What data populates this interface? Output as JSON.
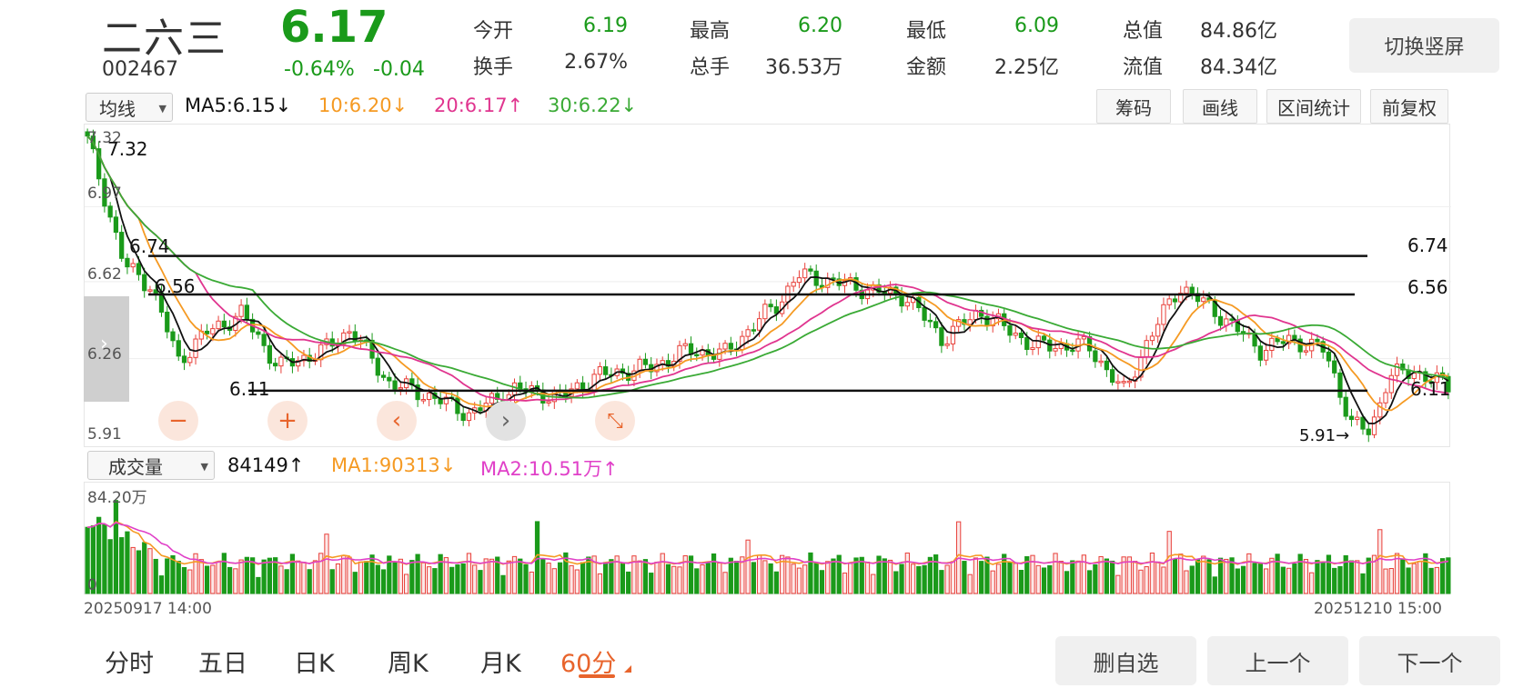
{
  "header": {
    "name": "二六三",
    "code": "002467",
    "price": "6.17",
    "change_pct": "-0.64%",
    "change_abs": "-0.04",
    "stats": [
      {
        "label": "今开",
        "value": "6.19",
        "color": "#1a9a1a"
      },
      {
        "label": "最高",
        "value": "6.20",
        "color": "#1a9a1a"
      },
      {
        "label": "最低",
        "value": "6.09",
        "color": "#1a9a1a"
      },
      {
        "label": "总值",
        "value": "84.86亿",
        "color": "#333333"
      },
      {
        "label": "换手",
        "value": "2.67%",
        "color": "#333333"
      },
      {
        "label": "总手",
        "value": "36.53万",
        "color": "#333333"
      },
      {
        "label": "金额",
        "value": "2.25亿",
        "color": "#333333"
      },
      {
        "label": "流值",
        "value": "84.34亿",
        "color": "#333333"
      }
    ],
    "switch_label": "切换竖屏"
  },
  "ma_bar": {
    "select_label": "均线",
    "ma5": "MA5:6.15↓",
    "ma10": "10:6.20↓",
    "ma20": "20:6.17↑",
    "ma30": "30:6.22↓",
    "tools": [
      "筹码",
      "画线",
      "区间统计",
      "前复权"
    ]
  },
  "price_chart": {
    "axis_labels": [
      "7.32",
      "6.97",
      "6.62",
      "6.26",
      "5.91"
    ],
    "level_labels": {
      "l674_left": "6.74",
      "l656_left": "6.56",
      "l611_left": "6.11",
      "l674_right": "6.74",
      "l656_right": "6.56",
      "l611_right": "6.11",
      "peak": "7.32",
      "low_marker": "5.91→"
    },
    "controls": {
      "zoom_out": "−",
      "zoom_in": "+",
      "prev": "‹",
      "next": "›",
      "collapse": "⤡"
    }
  },
  "volume_bar": {
    "select_label": "成交量",
    "vol": "84149↑",
    "ma1": "MA1:90313↓",
    "ma2": "MA2:10.51万↑",
    "axis_top": "84.20万",
    "axis_zero": "0"
  },
  "dates": {
    "start": "20250917 14:00",
    "end": "20251210 15:00"
  },
  "tabs": [
    "分时",
    "五日",
    "日K",
    "周K",
    "月K",
    "60分"
  ],
  "bottom_buttons": [
    "删自选",
    "上一个",
    "下一个"
  ],
  "colors": {
    "down": "#1a9a1a",
    "up": "#e8403a",
    "ma5": "#111111",
    "ma10": "#f59a23",
    "ma20": "#e0358f",
    "ma30": "#3aaa35",
    "accent": "#e8642c"
  }
}
